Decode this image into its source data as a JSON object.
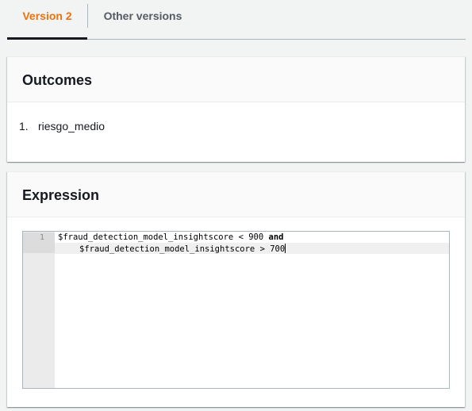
{
  "tabs": [
    {
      "label": "Version 2",
      "active": true
    },
    {
      "label": "Other versions",
      "active": false
    }
  ],
  "outcomes": {
    "title": "Outcomes",
    "items": [
      {
        "number": "1.",
        "label": "riesgo_medio"
      }
    ]
  },
  "expression": {
    "title": "Expression",
    "line_number": "1",
    "line1_text": "$fraud_detection_model_insightscore < 900 ",
    "line1_keyword": "and",
    "line2_text": "$fraud_detection_model_insightscore > 700"
  },
  "colors": {
    "active_tab": "#ec7211",
    "inactive_tab": "#545b64",
    "background": "#f2f3f3"
  }
}
